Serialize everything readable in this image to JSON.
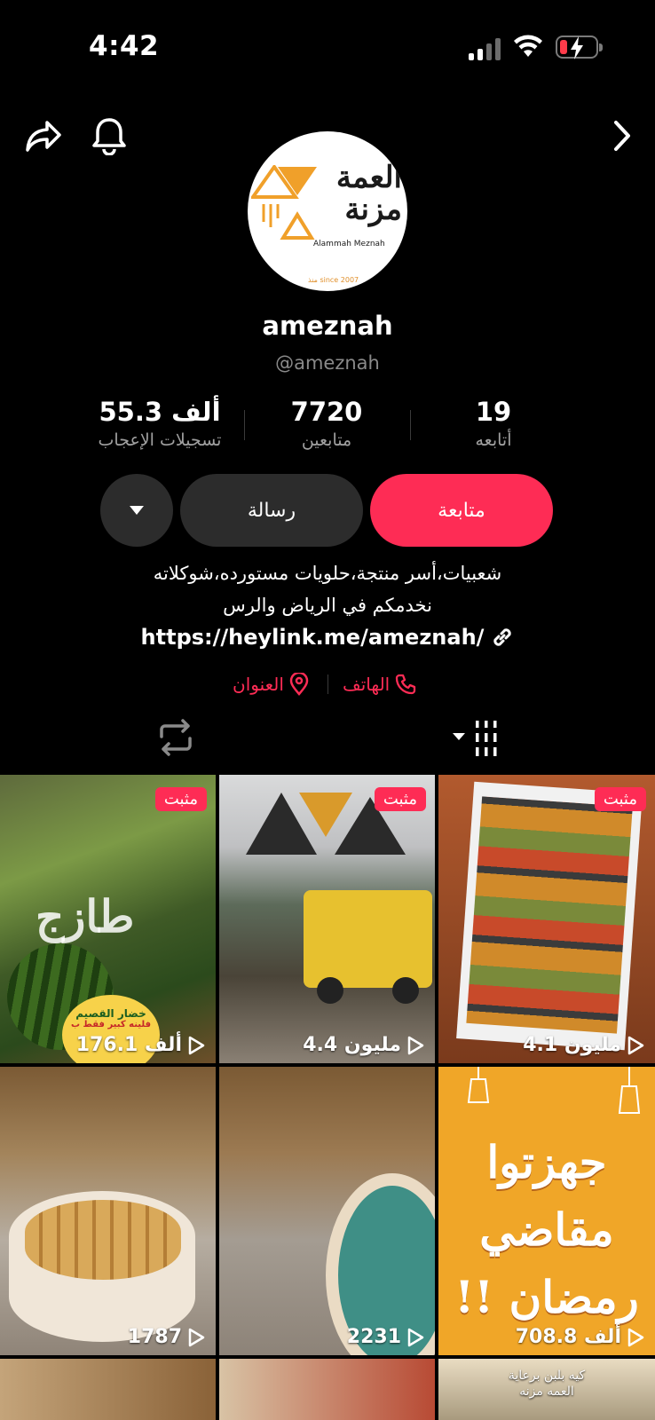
{
  "status_bar": {
    "time": "4:42"
  },
  "profile": {
    "logo": {
      "arabic": "العمة مزنة",
      "english": "Alammah Meznah",
      "since": "منذ since 2007"
    },
    "display_name": "ameznah",
    "handle": "@ameznah",
    "stats": [
      {
        "value": "55.3 ألف",
        "label": "تسجيلات الإعجاب"
      },
      {
        "value": "7720",
        "label": "متابعين"
      },
      {
        "value": "19",
        "label": "أتابعه"
      }
    ],
    "buttons": {
      "follow": "متابعة",
      "message": "رسالة"
    },
    "bio_lines": [
      "شعبيات،أسر منتجة،حلويات مستورده،شوكلاته",
      "نخدمكم في الرياض والرس"
    ],
    "link": "https://heylink.me/ameznah/",
    "contacts": {
      "phone": "الهاتف",
      "address": "العنوان"
    }
  },
  "videos": [
    {
      "views": "176.1 ألف",
      "pinned": "مثبت",
      "overlay_text": "طازج",
      "sticker_title": "خضار القصيم",
      "sticker_sub": "فلينه كبير فقط ب"
    },
    {
      "views": "4.4 مليون",
      "pinned": "مثبت"
    },
    {
      "views": "4.1 مليون",
      "pinned": "مثبت"
    },
    {
      "views": "1787"
    },
    {
      "views": "2231"
    },
    {
      "views": "708.8 ألف",
      "overlay_lines": [
        "جهزتوا",
        "مقاضي",
        "رمضان !!"
      ]
    },
    {
      "overlay_lines": [
        "كيه بلبن برعاية",
        "العمه مزنه"
      ]
    }
  ],
  "colors": {
    "accent": "#fe2c55",
    "background": "#000000",
    "secondary_button": "#2c2c2c"
  }
}
